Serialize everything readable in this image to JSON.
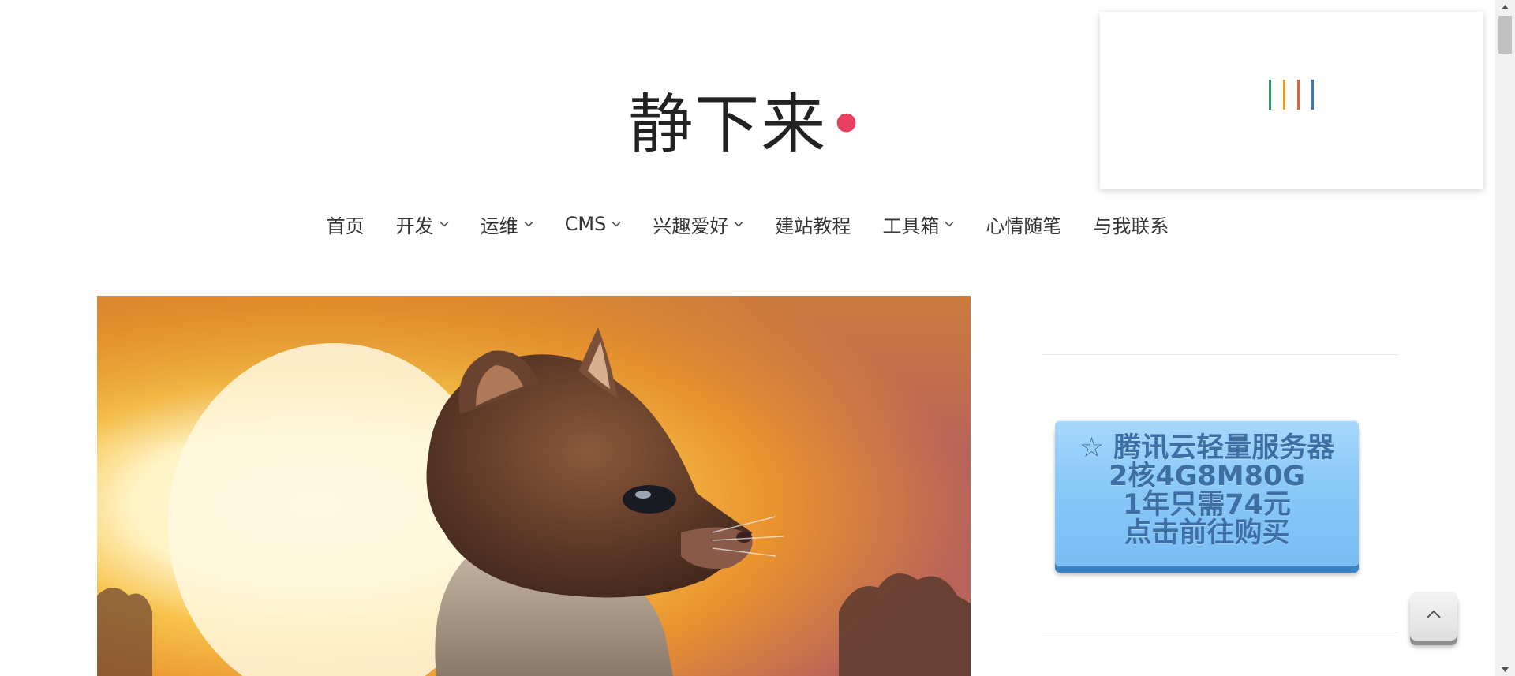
{
  "site": {
    "title": "静下来",
    "title_dot": "•",
    "accent_color": "#e8405e"
  },
  "nav": {
    "items": [
      {
        "label": "首页",
        "has_dropdown": false
      },
      {
        "label": "开发",
        "has_dropdown": true
      },
      {
        "label": "运维",
        "has_dropdown": true
      },
      {
        "label": "CMS",
        "has_dropdown": true
      },
      {
        "label": "兴趣爱好",
        "has_dropdown": true
      },
      {
        "label": "建站教程",
        "has_dropdown": false
      },
      {
        "label": "工具箱",
        "has_dropdown": true
      },
      {
        "label": "心情随笔",
        "has_dropdown": false
      },
      {
        "label": "与我联系",
        "has_dropdown": false
      }
    ]
  },
  "loader": {
    "bar_colors": [
      "#3a9a6e",
      "#e0a020",
      "#d9663a",
      "#3a7ab6"
    ]
  },
  "hero": {
    "image": "cartoon-cat-sunset-illustration"
  },
  "sidebar": {
    "promo": {
      "line1": "☆ 腾讯云轻量服务器",
      "line2": "2核4G8M80G",
      "line3": "1年只需74元",
      "line4": "点击前往购买",
      "text_color": "#3d6fa5"
    }
  },
  "back_to_top": {
    "icon": "chevron-up-icon"
  }
}
